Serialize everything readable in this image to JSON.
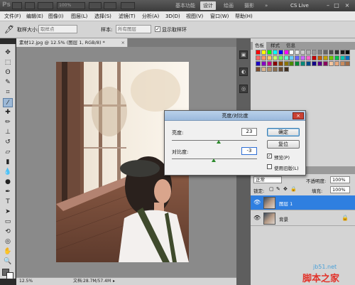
{
  "app": {
    "logo": "Ps",
    "zoom_display": "100%",
    "workspaces": [
      "基本功能",
      "设计",
      "绘画",
      "摄影"
    ],
    "active_workspace": "设计",
    "more": "»",
    "cs_live": "CS Live",
    "window_controls": [
      "–",
      "□",
      "×"
    ]
  },
  "menu": [
    "文件(F)",
    "编辑(E)",
    "图像(I)",
    "图层(L)",
    "选择(S)",
    "滤镜(T)",
    "分析(A)",
    "3D(D)",
    "视图(V)",
    "窗口(W)",
    "帮助(H)"
  ],
  "options": {
    "sample_size_label": "取样大小:",
    "sample_size_value": "取样点",
    "sample_label": "样本:",
    "sample_value": "所有图层",
    "show_ring_label": "显示取样环",
    "show_ring_checked": "✓"
  },
  "document": {
    "tab_title": "素材12.jpg @ 12.5% (图层 1, RGB/8) *",
    "tab_close": "×",
    "status_zoom": "12.5%",
    "status_doc": "文档:28.7M/57.4M"
  },
  "panels": {
    "color_tabs": [
      "色板",
      "样式",
      "信息"
    ],
    "active_color_tab": "色板",
    "layer_tabs": [
      "图层",
      "通道",
      "路径"
    ],
    "blend_mode": "正常",
    "opacity_label": "不透明度:",
    "opacity_value": "100%",
    "lock_label": "锁定:",
    "fill_label": "填充:",
    "fill_value": "100%",
    "layers": [
      {
        "name": "图层 1",
        "selected": true
      },
      {
        "name": "背景",
        "selected": false
      }
    ],
    "swatch_colors": [
      "#ff0000",
      "#ffff00",
      "#00ff00",
      "#00ffff",
      "#0000ff",
      "#ff00ff",
      "#ffffff",
      "#e6e6e6",
      "#cccccc",
      "#b3b3b3",
      "#999999",
      "#808080",
      "#666666",
      "#4d4d4d",
      "#333333",
      "#1a1a1a",
      "#000000",
      "#ff6666",
      "#ff9966",
      "#ffcc66",
      "#ccff66",
      "#66ff66",
      "#66ffcc",
      "#66ccff",
      "#6666ff",
      "#cc66ff",
      "#ff66cc",
      "#c40000",
      "#c45c00",
      "#c4a000",
      "#6ec400",
      "#00c44b",
      "#00c4b0",
      "#006ec4",
      "#1a00c4",
      "#8800c4",
      "#c40088",
      "#8a0000",
      "#8a4a00",
      "#8a7300",
      "#4a8a00",
      "#008a34",
      "#008a7a",
      "#004a8a",
      "#12008a",
      "#5d008a",
      "#8a005d",
      "#f4c6a0",
      "#e8a87c",
      "#c98b5e",
      "#a06a44",
      "#7a4c2e",
      "#d9b38c",
      "#b38f6a",
      "#8c6d4f",
      "#664d36",
      "#40301f"
    ]
  },
  "dialog": {
    "title": "亮度/对比度",
    "close": "×",
    "brightness_label": "亮度:",
    "brightness_value": "23",
    "brightness_level": 0.55,
    "contrast_label": "对比度:",
    "contrast_value": "-3",
    "contrast_level": 0.49,
    "ok": "确定",
    "reset": "复位",
    "preview_label": "预览(P)",
    "preview_checked": "✓",
    "legacy_label": "使用旧版(L)",
    "legacy_checked": ""
  },
  "watermark": {
    "site": "jb51.net",
    "name": "脚本之家"
  }
}
